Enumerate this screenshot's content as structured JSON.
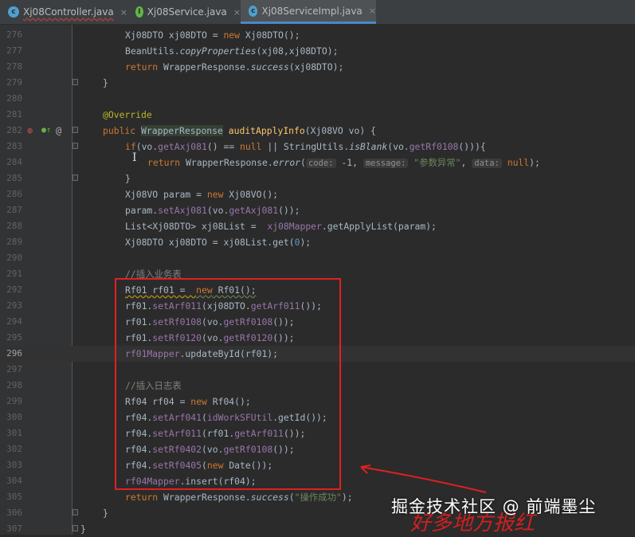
{
  "tabs": [
    {
      "label": "Xj08Controller.java",
      "icon": "c-class-icon"
    },
    {
      "label": "Xj08Service.java",
      "icon": "i-interface-icon"
    },
    {
      "label": "Xj08ServiceImpl.java",
      "icon": "c-class-icon",
      "active": true
    }
  ],
  "tab_close": "×",
  "icon_letters": {
    "class": "c",
    "interface": "I"
  },
  "gutter_icons": {
    "implements": "⊕",
    "override": "●↑",
    "annotation": "@"
  },
  "line_numbers": [
    "276",
    "277",
    "278",
    "279",
    "280",
    "281",
    "282",
    "283",
    "284",
    "285",
    "286",
    "287",
    "288",
    "289",
    "290",
    "291",
    "292",
    "293",
    "294",
    "295",
    "296",
    "297",
    "298",
    "299",
    "300",
    "301",
    "302",
    "303",
    "304",
    "305",
    "306",
    "307"
  ],
  "current_line": "296",
  "code": {
    "l276": {
      "t1": "Xj08DTO xj08DTO = ",
      "kw": "new",
      "t2": " Xj08DTO();"
    },
    "l277": {
      "t1": "BeanUtils.",
      "m": "copyProperties",
      "t2": "(xj08,xj08DTO);"
    },
    "l278": {
      "kw": "return",
      "t1": " WrapperResponse.",
      "m": "success",
      "t2": "(xj08DTO);"
    },
    "l279": "}",
    "l281": "@Override",
    "l282": {
      "kw": "public",
      "type": "WrapperResponse",
      "fn": "auditApplyInfo",
      "t": "(Xj08VO vo) {"
    },
    "l283": {
      "kw": "if",
      "a": "(vo.",
      "m1": "getAxj081",
      "b": "() == ",
      "null": "null",
      "c": " || StringUtils.",
      "m2": "isBlank",
      "d": "(vo.",
      "m3": "getRf0108",
      "e": "())){"
    },
    "l284": {
      "kw": "return",
      "a": " WrapperResponse.",
      "m": "error",
      "b": "(",
      "h1": "code:",
      "v1": " -1, ",
      "h2": "message:",
      "s": " \"参数异常\"",
      "c": ", ",
      "h3": "data:",
      "null": " null",
      "d": ");"
    },
    "l285": "}",
    "l286": {
      "a": "Xj08VO param = ",
      "kw": "new",
      "b": " Xj08VO();"
    },
    "l287": {
      "a": "param.",
      "m1": "setAxj081",
      "b": "(vo.",
      "m2": "getAxj081",
      "c": "());"
    },
    "l288": {
      "a": "List<Xj08DTO> xj08List =  ",
      "f": "xj08Mapper",
      "b": ".getApplyList(param);"
    },
    "l289": {
      "a": "Xj08DTO xj08DTO = xj08List.get(",
      "n": "0",
      "b": ");"
    },
    "l291": "//插入业务表",
    "l292": {
      "a": "Rf01 rf01 =  ",
      "kw": "new",
      "b": " Rf01();"
    },
    "l293": {
      "a": "rf01.",
      "m1": "setArf011",
      "b": "(xj08DTO.",
      "m2": "getArf011",
      "c": "());"
    },
    "l294": {
      "a": "rf01.",
      "m1": "setRf0108",
      "b": "(vo.",
      "m2": "getRf0108",
      "c": "());"
    },
    "l295": {
      "a": "rf01.",
      "m1": "setRf0120",
      "b": "(vo.",
      "m2": "getRf0120",
      "c": "());"
    },
    "l296": {
      "f": "rf01Mapper",
      "a": ".updateById(rf01);"
    },
    "l298": "//插入日志表",
    "l299": {
      "a": "Rf04 rf04 = ",
      "kw": "new",
      "b": " Rf04();"
    },
    "l300": {
      "a": "rf04.",
      "m1": "setArf041",
      "b": "(",
      "f": "idWorkSFUtil",
      "c": ".getId());"
    },
    "l301": {
      "a": "rf04.",
      "m1": "setArf011",
      "b": "(rf01.",
      "m2": "getArf011",
      "c": "());"
    },
    "l302": {
      "a": "rf04.",
      "m1": "setRf0402",
      "b": "(vo.",
      "m2": "getRf0108",
      "c": "());"
    },
    "l303": {
      "a": "rf04.",
      "m1": "setRf0405",
      "b": "(",
      "kw": "new",
      "c": " Date());"
    },
    "l304": {
      "f": "rf04Mapper",
      "a": ".insert(rf04);"
    },
    "l305": {
      "kw": "return",
      "a": " WrapperResponse.",
      "m": "success",
      "b": "(",
      "s": "\"操作成功\"",
      "c": ");"
    },
    "l306": "}",
    "l307": "}"
  },
  "watermark": "掘金技术社区 @ 前端墨尘",
  "handwritten_note": "好多地方报红",
  "colors": {
    "annotation_box": "#e02020",
    "editor_bg": "#2b2b2b"
  }
}
